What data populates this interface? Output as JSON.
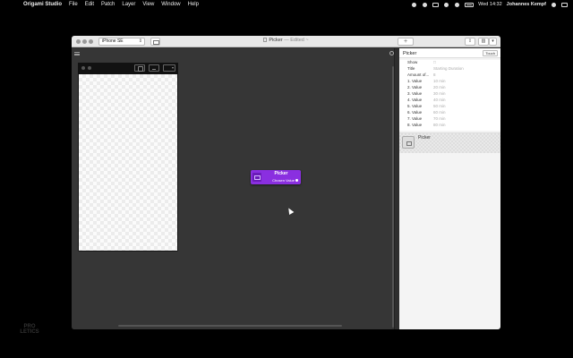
{
  "menubar": {
    "app_name": "Origami Studio",
    "menus": [
      "File",
      "Edit",
      "Patch",
      "Layer",
      "View",
      "Window",
      "Help"
    ],
    "clock": "Wed 14:32",
    "user": "Johannes Kempf"
  },
  "window": {
    "device": "iPhone SE",
    "doc_title": "Picker",
    "doc_status": "— Edited ~",
    "add_symbol": "+"
  },
  "node": {
    "title": "Picker",
    "output_port": "Chosen Value"
  },
  "inspector": {
    "title": "Picker",
    "touch_label": "Touch",
    "properties": [
      {
        "label": "Show",
        "value": "□"
      },
      {
        "label": "Title",
        "value": "Starting Duration"
      },
      {
        "label": "Amount of...",
        "value": "8"
      },
      {
        "label": "1. Value",
        "value": "10 min"
      },
      {
        "label": "2. Value",
        "value": "20 min"
      },
      {
        "label": "3. Value",
        "value": "30 min"
      },
      {
        "label": "4. Value",
        "value": "40 min"
      },
      {
        "label": "5. Value",
        "value": "50 min"
      },
      {
        "label": "6. Value",
        "value": "60 min"
      },
      {
        "label": "7. Value",
        "value": "70 min"
      },
      {
        "label": "8. Value",
        "value": "80 min"
      }
    ],
    "library_item": "Picker"
  },
  "watermark": "PRO LETICS"
}
